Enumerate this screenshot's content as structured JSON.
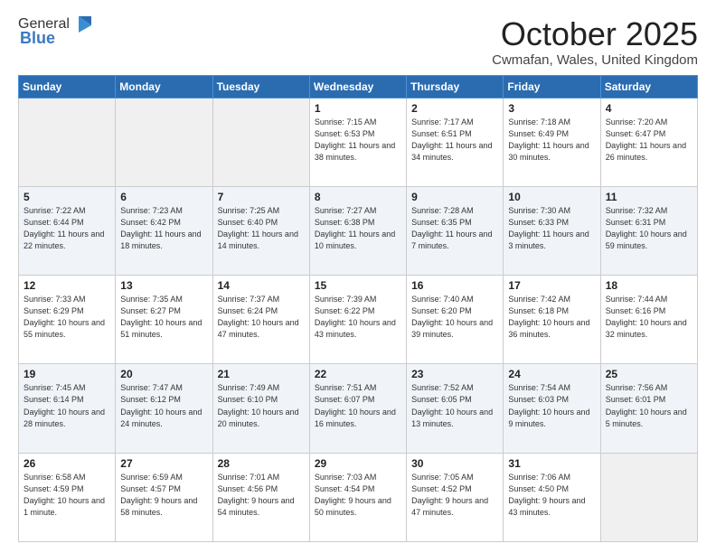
{
  "header": {
    "logo_general": "General",
    "logo_blue": "Blue",
    "month_title": "October 2025",
    "location": "Cwmafan, Wales, United Kingdom"
  },
  "weekdays": [
    "Sunday",
    "Monday",
    "Tuesday",
    "Wednesday",
    "Thursday",
    "Friday",
    "Saturday"
  ],
  "weeks": [
    {
      "days": [
        {
          "num": "",
          "empty": true
        },
        {
          "num": "",
          "empty": true
        },
        {
          "num": "",
          "empty": true
        },
        {
          "num": "1",
          "sunrise": "7:15 AM",
          "sunset": "6:53 PM",
          "daylight": "11 hours and 38 minutes."
        },
        {
          "num": "2",
          "sunrise": "7:17 AM",
          "sunset": "6:51 PM",
          "daylight": "11 hours and 34 minutes."
        },
        {
          "num": "3",
          "sunrise": "7:18 AM",
          "sunset": "6:49 PM",
          "daylight": "11 hours and 30 minutes."
        },
        {
          "num": "4",
          "sunrise": "7:20 AM",
          "sunset": "6:47 PM",
          "daylight": "11 hours and 26 minutes."
        }
      ]
    },
    {
      "days": [
        {
          "num": "5",
          "sunrise": "7:22 AM",
          "sunset": "6:44 PM",
          "daylight": "11 hours and 22 minutes."
        },
        {
          "num": "6",
          "sunrise": "7:23 AM",
          "sunset": "6:42 PM",
          "daylight": "11 hours and 18 minutes."
        },
        {
          "num": "7",
          "sunrise": "7:25 AM",
          "sunset": "6:40 PM",
          "daylight": "11 hours and 14 minutes."
        },
        {
          "num": "8",
          "sunrise": "7:27 AM",
          "sunset": "6:38 PM",
          "daylight": "11 hours and 10 minutes."
        },
        {
          "num": "9",
          "sunrise": "7:28 AM",
          "sunset": "6:35 PM",
          "daylight": "11 hours and 7 minutes."
        },
        {
          "num": "10",
          "sunrise": "7:30 AM",
          "sunset": "6:33 PM",
          "daylight": "11 hours and 3 minutes."
        },
        {
          "num": "11",
          "sunrise": "7:32 AM",
          "sunset": "6:31 PM",
          "daylight": "10 hours and 59 minutes."
        }
      ]
    },
    {
      "days": [
        {
          "num": "12",
          "sunrise": "7:33 AM",
          "sunset": "6:29 PM",
          "daylight": "10 hours and 55 minutes."
        },
        {
          "num": "13",
          "sunrise": "7:35 AM",
          "sunset": "6:27 PM",
          "daylight": "10 hours and 51 minutes."
        },
        {
          "num": "14",
          "sunrise": "7:37 AM",
          "sunset": "6:24 PM",
          "daylight": "10 hours and 47 minutes."
        },
        {
          "num": "15",
          "sunrise": "7:39 AM",
          "sunset": "6:22 PM",
          "daylight": "10 hours and 43 minutes."
        },
        {
          "num": "16",
          "sunrise": "7:40 AM",
          "sunset": "6:20 PM",
          "daylight": "10 hours and 39 minutes."
        },
        {
          "num": "17",
          "sunrise": "7:42 AM",
          "sunset": "6:18 PM",
          "daylight": "10 hours and 36 minutes."
        },
        {
          "num": "18",
          "sunrise": "7:44 AM",
          "sunset": "6:16 PM",
          "daylight": "10 hours and 32 minutes."
        }
      ]
    },
    {
      "days": [
        {
          "num": "19",
          "sunrise": "7:45 AM",
          "sunset": "6:14 PM",
          "daylight": "10 hours and 28 minutes."
        },
        {
          "num": "20",
          "sunrise": "7:47 AM",
          "sunset": "6:12 PM",
          "daylight": "10 hours and 24 minutes."
        },
        {
          "num": "21",
          "sunrise": "7:49 AM",
          "sunset": "6:10 PM",
          "daylight": "10 hours and 20 minutes."
        },
        {
          "num": "22",
          "sunrise": "7:51 AM",
          "sunset": "6:07 PM",
          "daylight": "10 hours and 16 minutes."
        },
        {
          "num": "23",
          "sunrise": "7:52 AM",
          "sunset": "6:05 PM",
          "daylight": "10 hours and 13 minutes."
        },
        {
          "num": "24",
          "sunrise": "7:54 AM",
          "sunset": "6:03 PM",
          "daylight": "10 hours and 9 minutes."
        },
        {
          "num": "25",
          "sunrise": "7:56 AM",
          "sunset": "6:01 PM",
          "daylight": "10 hours and 5 minutes."
        }
      ]
    },
    {
      "days": [
        {
          "num": "26",
          "sunrise": "6:58 AM",
          "sunset": "4:59 PM",
          "daylight": "10 hours and 1 minute."
        },
        {
          "num": "27",
          "sunrise": "6:59 AM",
          "sunset": "4:57 PM",
          "daylight": "9 hours and 58 minutes."
        },
        {
          "num": "28",
          "sunrise": "7:01 AM",
          "sunset": "4:56 PM",
          "daylight": "9 hours and 54 minutes."
        },
        {
          "num": "29",
          "sunrise": "7:03 AM",
          "sunset": "4:54 PM",
          "daylight": "9 hours and 50 minutes."
        },
        {
          "num": "30",
          "sunrise": "7:05 AM",
          "sunset": "4:52 PM",
          "daylight": "9 hours and 47 minutes."
        },
        {
          "num": "31",
          "sunrise": "7:06 AM",
          "sunset": "4:50 PM",
          "daylight": "9 hours and 43 minutes."
        },
        {
          "num": "",
          "empty": true
        }
      ]
    }
  ]
}
